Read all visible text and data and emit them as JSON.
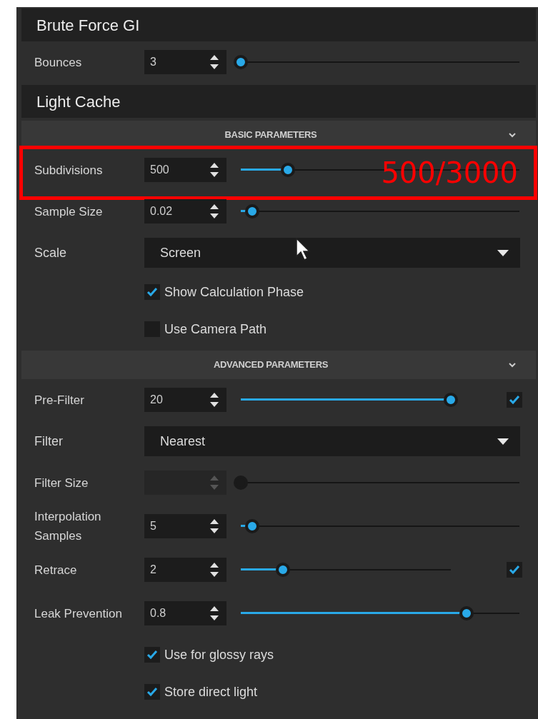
{
  "sections": [
    {
      "title": "Brute Force GI",
      "rows": [
        {
          "kind": "spinner",
          "label": "Bounces",
          "value": "3",
          "level": 0.0
        }
      ]
    },
    {
      "title": "Light Cache",
      "rows": [
        {
          "kind": "subheader",
          "label": "BASIC PARAMETERS",
          "expanded": true
        },
        {
          "kind": "spinner",
          "label": "Subdivisions",
          "value": "500",
          "level": 0.17,
          "annotation": "500/3000"
        },
        {
          "kind": "spinner",
          "label": "Sample Size",
          "value": "0.02",
          "level": 0.04
        },
        {
          "kind": "dropdown",
          "label": "Scale",
          "value": "Screen"
        },
        {
          "kind": "checkbox",
          "label": "Show Calculation Phase",
          "checked": true
        },
        {
          "kind": "checkbox",
          "label": "Use Camera Path",
          "checked": false
        },
        {
          "kind": "subheader",
          "label": "ADVANCED PARAMETERS",
          "expanded": true
        },
        {
          "kind": "spinner",
          "label": "Pre-Filter",
          "value": "20",
          "level": 1.0,
          "checked": true
        },
        {
          "kind": "dropdown",
          "label": "Filter",
          "value": "Nearest"
        },
        {
          "kind": "spinner",
          "label": "Filter Size",
          "disabled": true,
          "level": 0.0
        },
        {
          "kind": "spinner",
          "label": "Interpolation Samples",
          "value": "5",
          "level": 0.04
        },
        {
          "kind": "spinner",
          "label": "Retrace",
          "value": "2",
          "level": 0.2,
          "checked": true
        },
        {
          "kind": "spinner",
          "label": "Leak Prevention",
          "value": "0.8",
          "level": 0.81
        },
        {
          "kind": "checkbox",
          "label": "Use for glossy rays",
          "checked": true
        },
        {
          "kind": "checkbox",
          "label": "Store direct light",
          "checked": true
        }
      ]
    }
  ]
}
